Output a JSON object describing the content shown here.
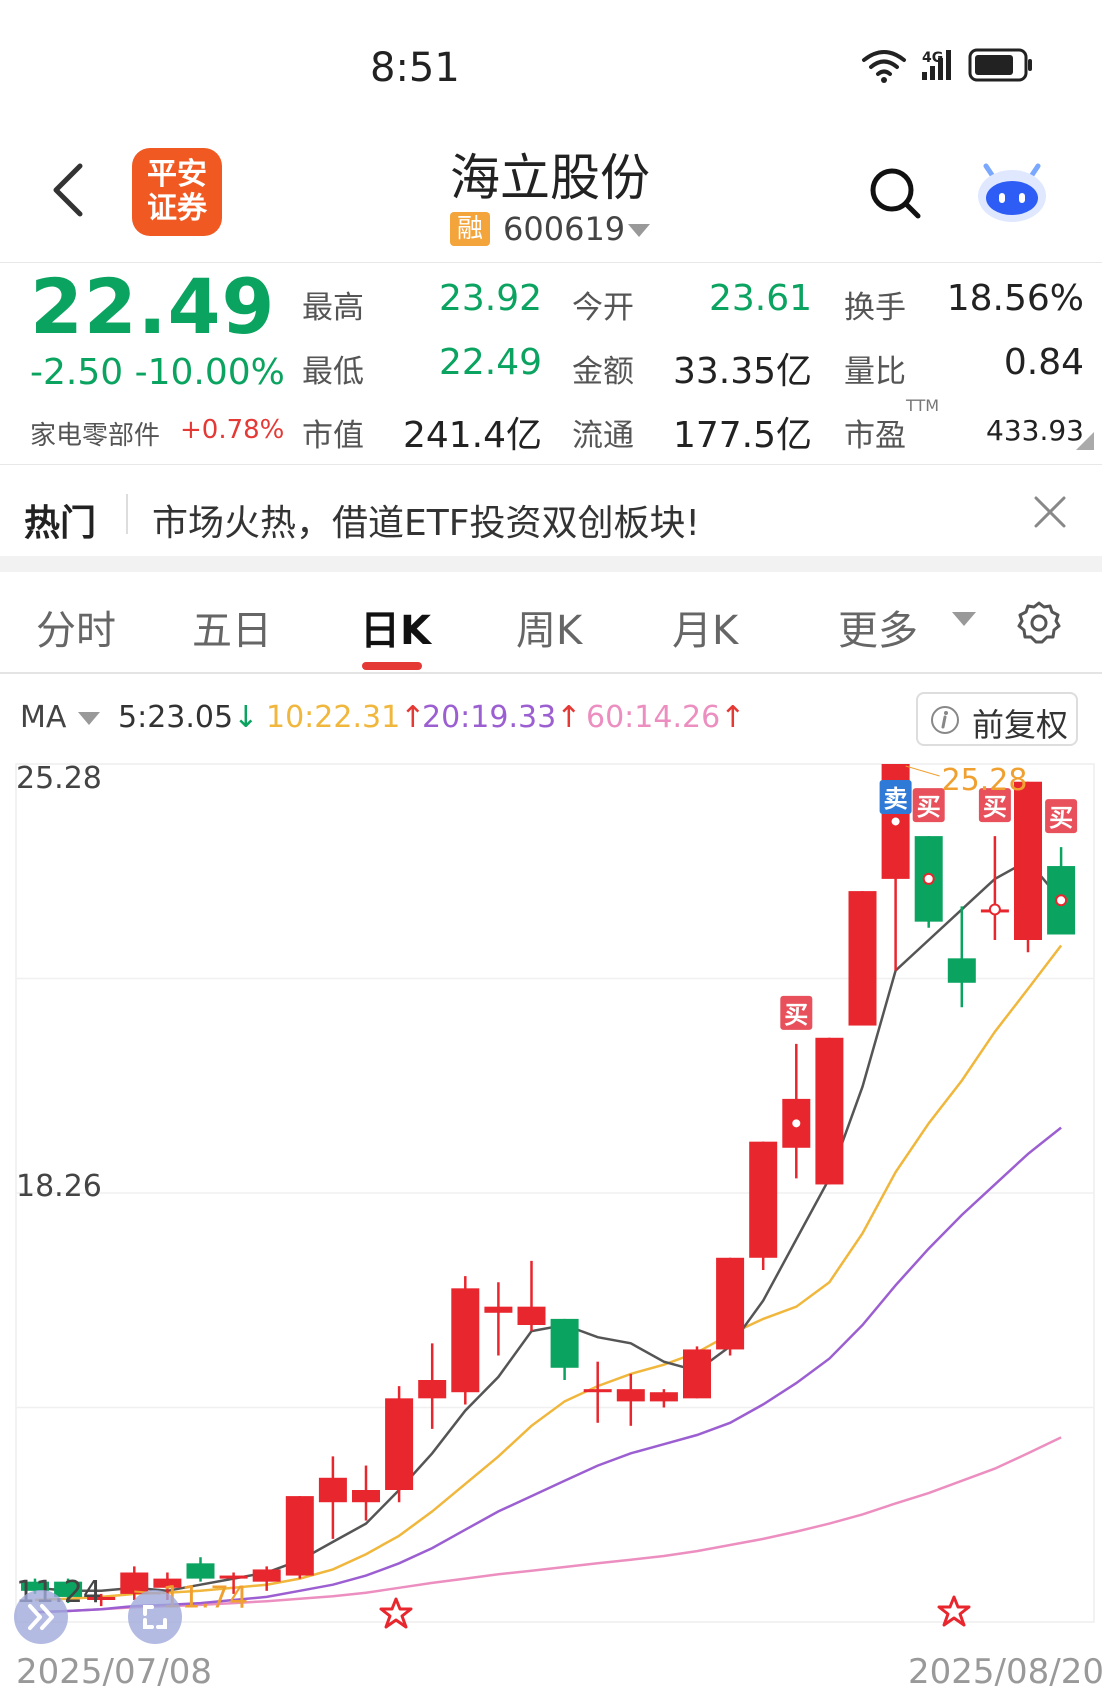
{
  "status": {
    "time": "8:51",
    "network": "4G"
  },
  "header": {
    "logo_text": "平安证券",
    "title": "海立股份",
    "badge": "融",
    "code": "600619"
  },
  "quote": {
    "price": "22.49",
    "change": "-2.50",
    "change_pct": "-10.00%",
    "sector": "家电零部件",
    "sector_pct": "+0.78%",
    "fields": [
      {
        "label": "最高",
        "value": "23.92"
      },
      {
        "label": "今开",
        "value": "23.61"
      },
      {
        "label": "换手",
        "value": "18.56%"
      },
      {
        "label": "最低",
        "value": "22.49"
      },
      {
        "label": "金额",
        "value": "33.35亿"
      },
      {
        "label": "量比",
        "value": "0.84"
      },
      {
        "label": "市值",
        "value": "241.4亿"
      },
      {
        "label": "流通",
        "value": "177.5亿"
      },
      {
        "label": "市盈",
        "value": "433.93"
      }
    ],
    "ttm": "TTM"
  },
  "hot": {
    "label": "热门",
    "text": "市场火热，借道ETF投资双创板块!"
  },
  "tabs": [
    "分时",
    "五日",
    "日K",
    "周K",
    "月K",
    "更多"
  ],
  "ma": {
    "label": "MA",
    "items": [
      {
        "text": "5:23.05",
        "arrow": "↓",
        "color": "#333333"
      },
      {
        "text": "10:22.31",
        "arrow": "↑",
        "color": "#f0b73c"
      },
      {
        "text": "20:19.33",
        "arrow": "↑",
        "color": "#9c5fd1"
      },
      {
        "text": "60:14.26",
        "arrow": "↑",
        "color": "#ec8fc0"
      }
    ],
    "adjust": "前复权"
  },
  "chart_data": {
    "type": "candlestick",
    "ymax_label": "25.28",
    "ymid_label": "18.26",
    "ymin_label": "11.24",
    "ylim": [
      11.24,
      25.28
    ],
    "start_date": "2025/07/08",
    "end_date": "2025/08/20",
    "high_annotation": "25.28",
    "low_annotation": "11.74",
    "candles": [
      {
        "o": 11.9,
        "h": 11.95,
        "l": 11.7,
        "c": 11.75
      },
      {
        "o": 11.9,
        "h": 11.95,
        "l": 11.55,
        "c": 11.65
      },
      {
        "o": 11.6,
        "h": 11.7,
        "l": 11.5,
        "c": 11.65
      },
      {
        "o": 11.7,
        "h": 12.15,
        "l": 11.6,
        "c": 12.05
      },
      {
        "o": 11.8,
        "h": 12.05,
        "l": 11.6,
        "c": 11.95
      },
      {
        "o": 12.2,
        "h": 12.3,
        "l": 11.9,
        "c": 11.95
      },
      {
        "o": 11.95,
        "h": 12.05,
        "l": 11.7,
        "c": 12.0
      },
      {
        "o": 11.9,
        "h": 12.15,
        "l": 11.75,
        "c": 12.1
      },
      {
        "o": 12.0,
        "h": 13.3,
        "l": 11.95,
        "c": 13.3
      },
      {
        "o": 13.2,
        "h": 13.95,
        "l": 12.6,
        "c": 13.6
      },
      {
        "o": 13.2,
        "h": 13.8,
        "l": 12.9,
        "c": 13.4
      },
      {
        "o": 13.4,
        "h": 15.1,
        "l": 13.2,
        "c": 14.9
      },
      {
        "o": 14.9,
        "h": 15.8,
        "l": 14.4,
        "c": 15.2
      },
      {
        "o": 15.0,
        "h": 16.9,
        "l": 14.8,
        "c": 16.7
      },
      {
        "o": 16.3,
        "h": 16.8,
        "l": 15.6,
        "c": 16.4
      },
      {
        "o": 16.1,
        "h": 17.15,
        "l": 16.0,
        "c": 16.4
      },
      {
        "o": 16.2,
        "h": 16.2,
        "l": 15.2,
        "c": 15.4
      },
      {
        "o": 15.0,
        "h": 15.5,
        "l": 14.5,
        "c": 15.05
      },
      {
        "o": 14.85,
        "h": 15.3,
        "l": 14.45,
        "c": 15.05
      },
      {
        "o": 14.85,
        "h": 15.05,
        "l": 14.75,
        "c": 15.0
      },
      {
        "o": 14.9,
        "h": 15.75,
        "l": 14.9,
        "c": 15.7
      },
      {
        "o": 15.7,
        "h": 17.2,
        "l": 15.6,
        "c": 17.2
      },
      {
        "o": 17.2,
        "h": 19.1,
        "l": 17.0,
        "c": 19.1
      },
      {
        "o": 19.0,
        "h": 20.7,
        "l": 18.5,
        "c": 19.8
      },
      {
        "o": 18.4,
        "h": 20.8,
        "l": 18.4,
        "c": 20.8
      },
      {
        "o": 21.0,
        "h": 23.2,
        "l": 21.0,
        "c": 23.2
      },
      {
        "o": 23.4,
        "h": 25.28,
        "l": 21.9,
        "c": 25.28
      },
      {
        "o": 24.1,
        "h": 24.1,
        "l": 22.6,
        "c": 22.7
      },
      {
        "o": 22.1,
        "h": 22.95,
        "l": 21.3,
        "c": 21.7
      },
      {
        "o": 22.9,
        "h": 24.1,
        "l": 22.4,
        "c": 22.9
      },
      {
        "o": 22.4,
        "h": 24.99,
        "l": 22.2,
        "c": 24.99
      },
      {
        "o": 23.61,
        "h": 23.92,
        "l": 22.49,
        "c": 22.49
      }
    ],
    "ma5": [
      11.8,
      11.75,
      11.75,
      11.8,
      11.75,
      11.85,
      11.95,
      12.05,
      12.25,
      12.55,
      12.85,
      13.4,
      14.0,
      14.7,
      15.25,
      16.0,
      16.1,
      15.9,
      15.8,
      15.5,
      15.35,
      15.75,
      16.5,
      17.5,
      18.5,
      20.0,
      21.9,
      22.4,
      22.9,
      23.4,
      23.7,
      23.05
    ],
    "ma10": [
      11.6,
      11.62,
      11.65,
      11.7,
      11.72,
      11.75,
      11.8,
      11.85,
      11.95,
      12.1,
      12.35,
      12.65,
      13.05,
      13.5,
      13.95,
      14.45,
      14.85,
      15.1,
      15.3,
      15.45,
      15.65,
      15.95,
      16.2,
      16.4,
      16.8,
      17.6,
      18.6,
      19.4,
      20.1,
      20.9,
      21.6,
      22.31
    ],
    "ma20": [
      11.4,
      11.42,
      11.45,
      11.5,
      11.52,
      11.55,
      11.6,
      11.65,
      11.75,
      11.85,
      12.0,
      12.2,
      12.45,
      12.75,
      13.05,
      13.3,
      13.55,
      13.8,
      14.0,
      14.15,
      14.3,
      14.5,
      14.8,
      15.15,
      15.55,
      16.1,
      16.75,
      17.35,
      17.9,
      18.4,
      18.9,
      19.33
    ],
    "ma60": [
      11.4,
      11.42,
      11.45,
      11.48,
      11.5,
      11.52,
      11.55,
      11.58,
      11.62,
      11.66,
      11.72,
      11.8,
      11.88,
      11.95,
      12.02,
      12.08,
      12.14,
      12.2,
      12.26,
      12.32,
      12.4,
      12.5,
      12.6,
      12.72,
      12.85,
      13.0,
      13.18,
      13.35,
      13.55,
      13.75,
      14.0,
      14.26
    ],
    "signals": [
      {
        "i": 23,
        "label": "买",
        "kind": "buy"
      },
      {
        "i": 26,
        "label": "卖",
        "kind": "sell"
      },
      {
        "i": 27,
        "label": "买",
        "kind": "buy"
      },
      {
        "i": 29,
        "label": "买",
        "kind": "buy"
      },
      {
        "i": 31,
        "label": "买",
        "kind": "buy"
      }
    ],
    "colors": {
      "up": "#e8262d",
      "down": "#0ba360",
      "ma5": "#555555",
      "ma10": "#f0b73c",
      "ma20": "#9c5fd1",
      "ma60": "#ec8fc0"
    }
  }
}
